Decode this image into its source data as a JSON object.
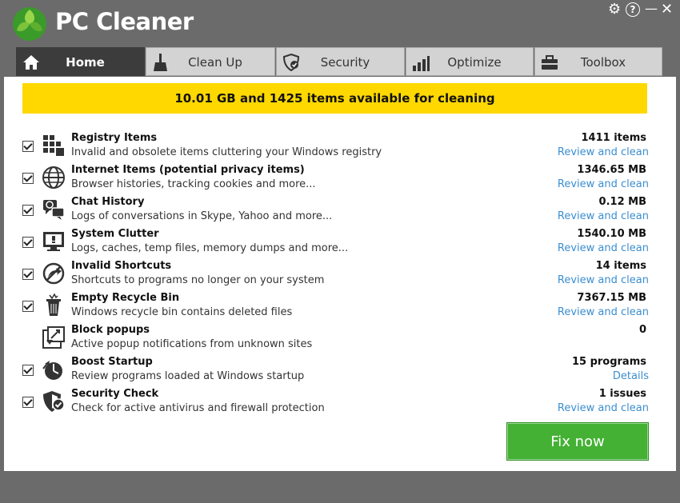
{
  "app": {
    "title": "PC Cleaner",
    "brand_color": "#44b135"
  },
  "window_controls": {
    "settings": "⚙",
    "help": "?",
    "minimize": "—",
    "close": "✕"
  },
  "tabs": [
    {
      "label": "Home",
      "icon": "home-icon",
      "active": true
    },
    {
      "label": "Clean Up",
      "icon": "broom-icon",
      "active": false
    },
    {
      "label": "Security",
      "icon": "shield-icon",
      "active": false
    },
    {
      "label": "Optimize",
      "icon": "bar-chart-icon",
      "active": false
    },
    {
      "label": "Toolbox",
      "icon": "toolbox-icon",
      "active": false
    }
  ],
  "banner": {
    "text": "10.01 GB and 1425 items available for cleaning",
    "color": "#ffd800"
  },
  "items": [
    {
      "title": "Registry Items",
      "desc": "Invalid and obsolete items cluttering your Windows registry",
      "value": "1411  items",
      "link": "Review and clean",
      "checked": true,
      "icon": "registry-icon"
    },
    {
      "title": "Internet Items (potential privacy items)",
      "desc": "Browser histories, tracking cookies and more...",
      "value": "1346.65  MB",
      "link": "Review and clean",
      "checked": true,
      "icon": "globe-icon"
    },
    {
      "title": "Chat History",
      "desc": "Logs of conversations in Skype, Yahoo and more...",
      "value": "0.12  MB",
      "link": "Review and clean",
      "checked": true,
      "icon": "chat-icon"
    },
    {
      "title": "System Clutter",
      "desc": "Logs, caches, temp files, memory dumps and more...",
      "value": "1540.10  MB",
      "link": "Review and clean",
      "checked": true,
      "icon": "monitor-icon"
    },
    {
      "title": "Invalid Shortcuts",
      "desc": "Shortcuts to programs no longer on your system",
      "value": "14  items",
      "link": "Review and clean",
      "checked": true,
      "icon": "shortcut-icon"
    },
    {
      "title": "Empty Recycle Bin",
      "desc": "Windows recycle bin contains deleted files",
      "value": "7367.15  MB",
      "link": "Review and clean",
      "checked": true,
      "icon": "recycle-bin-icon"
    },
    {
      "title": "Block popups",
      "desc": "Active popup notifications from unknown sites",
      "value": "0",
      "link": "",
      "checked": false,
      "icon": "popup-icon"
    },
    {
      "title": "Boost Startup",
      "desc": "Review programs loaded at Windows startup",
      "value": "15  programs",
      "link": "Details",
      "checked": true,
      "icon": "startup-icon"
    },
    {
      "title": "Security Check",
      "desc": "Check for active antivirus and firewall protection",
      "value": "1  issues",
      "link": "Review and clean",
      "checked": true,
      "icon": "security-shield-icon"
    }
  ],
  "fix_button": {
    "label": "Fix now"
  }
}
